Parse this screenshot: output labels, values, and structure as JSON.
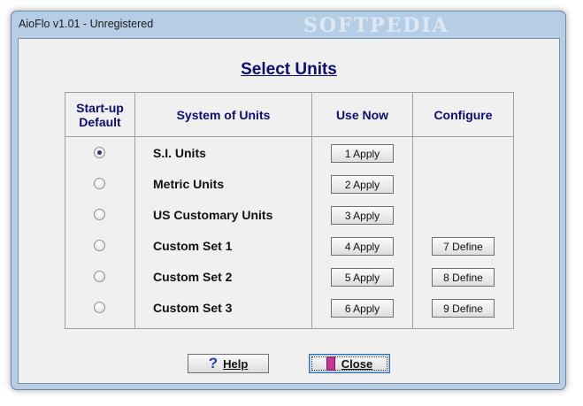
{
  "window": {
    "title": "AioFlo  v1.01 - Unregistered",
    "watermark": "SOFTPEDIA"
  },
  "dialog": {
    "heading": "Select Units",
    "headers": {
      "startup": "Start-up Default",
      "system": "System of Units",
      "use_now": "Use Now",
      "configure": "Configure"
    },
    "rows": [
      {
        "label": "S.I. Units",
        "apply": "1  Apply",
        "define": null,
        "selected": true
      },
      {
        "label": "Metric Units",
        "apply": "2  Apply",
        "define": null,
        "selected": false
      },
      {
        "label": "US Customary Units",
        "apply": "3  Apply",
        "define": null,
        "selected": false
      },
      {
        "label": "Custom Set 1",
        "apply": "4  Apply",
        "define": "7  Define",
        "selected": false
      },
      {
        "label": "Custom Set 2",
        "apply": "5  Apply",
        "define": "8  Define",
        "selected": false
      },
      {
        "label": "Custom Set 3",
        "apply": "6  Apply",
        "define": "9  Define",
        "selected": false
      }
    ],
    "buttons": {
      "help_icon": "question-mark-icon",
      "help_label": "Help",
      "close_icon": "door-exit-icon",
      "close_label": "Close"
    }
  }
}
